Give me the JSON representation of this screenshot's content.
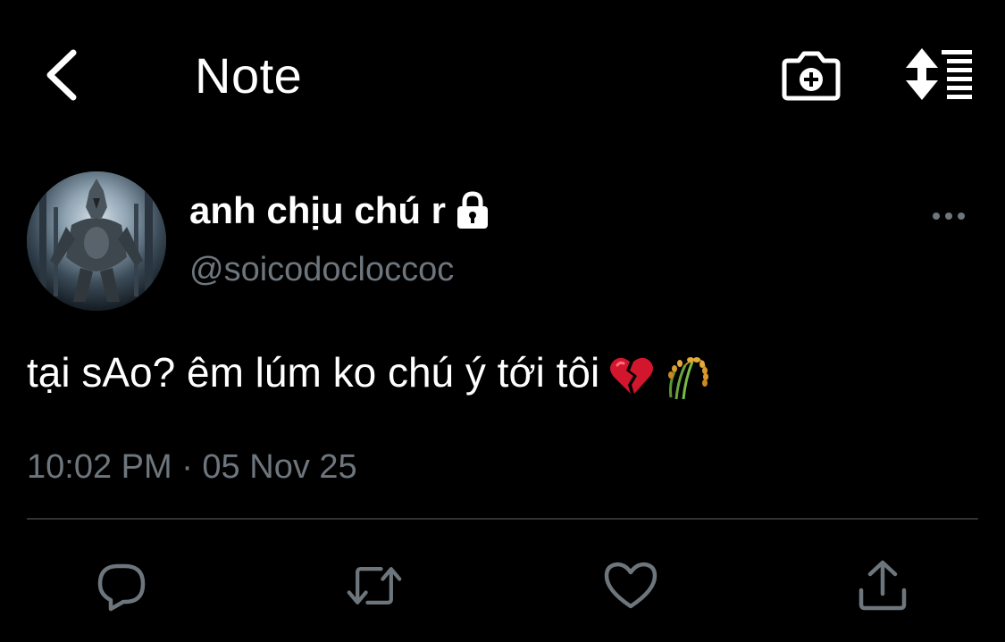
{
  "header": {
    "title": "Note",
    "back_icon": "chevron-left-icon",
    "camera_icon": "camera-plus-icon",
    "sort_icon": "sort-list-icon"
  },
  "tweet": {
    "display_name": "anh chịu chú r",
    "handle": "@soicodocloccoc",
    "text": "tại sAo? êm lúm ko chú ý tới tôi",
    "emojis": [
      "broken-heart",
      "rice-sheaf"
    ],
    "timestamp": "10:02 PM · 05 Nov 25",
    "protected": true
  },
  "actions": [
    {
      "name": "reply",
      "icon": "reply-icon"
    },
    {
      "name": "retweet",
      "icon": "retweet-icon"
    },
    {
      "name": "like",
      "icon": "heart-icon"
    },
    {
      "name": "share",
      "icon": "share-icon"
    }
  ],
  "colors": {
    "background": "#000000",
    "primary_text": "#ffffff",
    "secondary_text": "#6e767d",
    "divider": "#2f3336"
  }
}
